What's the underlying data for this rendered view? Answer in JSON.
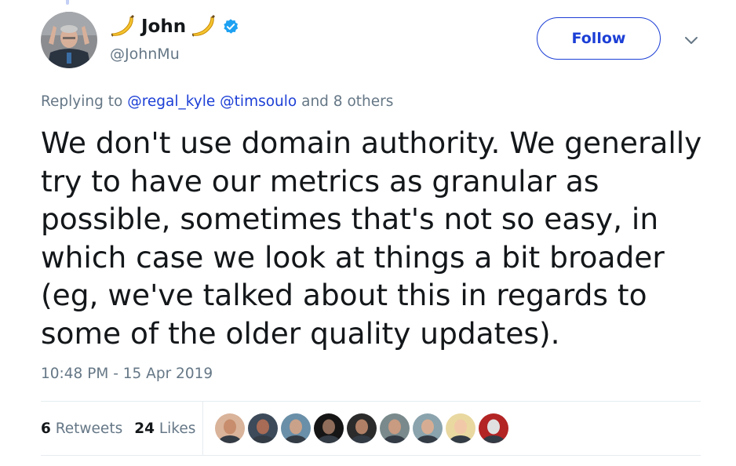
{
  "user": {
    "name": "John",
    "handle": "@JohnMu",
    "name_prefix_emoji": "banana-icon",
    "name_suffix_emoji": "banana-icon",
    "verified": true
  },
  "follow_label": "Follow",
  "reply": {
    "prefix": "Replying to",
    "mentions": [
      "@regal_kyle",
      "@timsoulo"
    ],
    "suffix": "and 8 others"
  },
  "tweet": {
    "text": "We don't use domain authority. We generally try to have our metrics as granular as possible, sometimes that's not so easy, in which case we look at things a bit broader (eg, we've talked about this in regards to some of the older quality updates).",
    "timestamp": "10:48 PM - 15 Apr 2019"
  },
  "stats": {
    "retweets_count": "6",
    "retweets_label": "Retweets",
    "likes_count": "24",
    "likes_label": "Likes"
  },
  "colors": {
    "link": "#1c3fd6",
    "secondary_text": "#657786",
    "verified": "#1da1f2",
    "divider": "#e6ecf0"
  },
  "likers": [
    {
      "bg": "#d9b39a",
      "face": "#c78d6c"
    },
    {
      "bg": "#3c4a5a",
      "face": "#a86b55"
    },
    {
      "bg": "#6a8fa8",
      "face": "#caa28a"
    },
    {
      "bg": "#151515",
      "face": "#8f6d5a"
    },
    {
      "bg": "#2b2b2b",
      "face": "#b08066"
    },
    {
      "bg": "#7a8a8c",
      "face": "#c99b81"
    },
    {
      "bg": "#8aa3ad",
      "face": "#d6ad93"
    },
    {
      "bg": "#e9d8a0",
      "face": "#f1c9a8"
    },
    {
      "bg": "#b32424",
      "face": "#e0e0e0"
    }
  ]
}
